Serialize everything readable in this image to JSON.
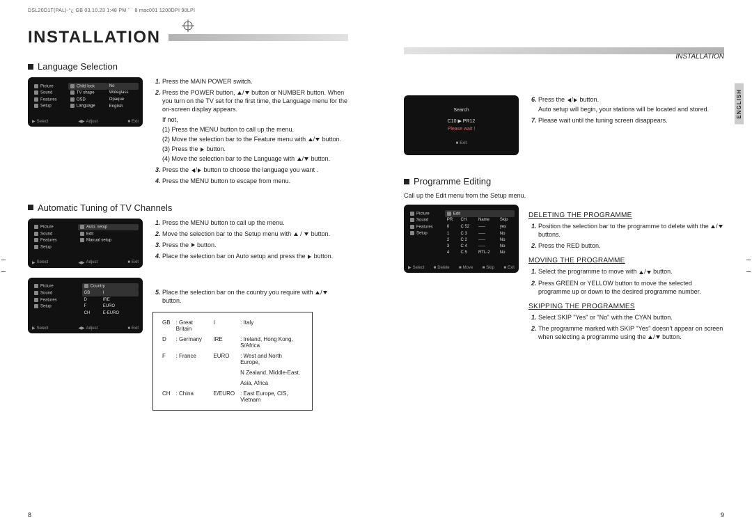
{
  "meta": {
    "print_header": "DSL20D1T(PAL)-°¿ GB  03.10.23 1:48 PM  ˘  ` 8   mac001   1200DPI 90LPI"
  },
  "left": {
    "title": "INSTALLATION",
    "sec_lang": "Language Selection",
    "sec_auto": "Automatic Tuning of TV Channels",
    "osd1": {
      "bot_select": "Select",
      "bot_adjust": "Adjust",
      "bot_exit": "Exit",
      "r1a": "Picture",
      "r1b": "Child lock",
      "r1c": "No",
      "r2a": "Sound",
      "r2b": "TV shape",
      "r2c": "Wideglass",
      "r3a": "Features",
      "r3b": "OSD",
      "r3c": "Opaque",
      "r4a": "Setup",
      "r4b": "Language",
      "r4c": "English"
    },
    "osd2": {
      "r1a": "Picture",
      "r1b": "Auto. setup",
      "r2a": "Sound",
      "r2b": "Edit",
      "r3a": "Features",
      "r3b": "Manual setup",
      "r4a": "Setup"
    },
    "osd3": {
      "r1a": "Picture",
      "r1b": "Country",
      "r2a": "Sound",
      "r2b": "GB",
      "r2c": "I",
      "r3a": "Features",
      "r3b": "D",
      "r3c": "IRE",
      "r4a": "Setup",
      "r4b": "F",
      "r4c": "EURO",
      "r5b": "CH",
      "r5c": "E-EURO"
    },
    "lang_steps": {
      "s1": "Press the MAIN POWER switch.",
      "s2a": "Press the POWER button, ",
      "s2b": " button or NUMBER button.  When you turn on the TV set for the first time, the Language menu for the on-screen display appears.",
      "s2c": "If not,",
      "s2d": "(1) Press the MENU button to call up the menu.",
      "s2e": "(2) Move the selection bar to the Feature menu with ",
      "s2f": " button.",
      "s2g": "(3) Press the ",
      "s2h": " button.",
      "s2i": "(4) Move the selection bar to the Language with ",
      "s2j": " button.",
      "s3a": "Press the ",
      "s3b": " button to choose the language you want .",
      "s4": "Press the MENU button to escape from menu."
    },
    "auto_steps": {
      "s1": "Press the MENU button to call up the menu.",
      "s2a": "Move the selection bar to the Setup menu with ",
      "s2b": " button.",
      "s3a": "Press the ",
      "s3b": " button.",
      "s4a": "Place the selection bar on Auto setup and press the ",
      "s4b": " button.",
      "s5a": "Place the selection bar on the country you require with ",
      "s5b": " button."
    },
    "countries": {
      "gb_a": "GB",
      "gb_b": ": Great Britain",
      "i_a": "I",
      "i_b": ": Italy",
      "d_a": "D",
      "d_b": ": Germany",
      "ire_a": "IRE",
      "ire_b": ": Ireland, Hong Kong, S/Africa",
      "f_a": "F",
      "f_b": ": France",
      "euro_a": "EURO",
      "euro_b": ": West and North Europe,",
      "euro_c": "N Zealand, Middle-East,",
      "euro_d": "Asia, Africa",
      "ch_a": "CH",
      "ch_b": ": China",
      "ee_a": "E/EURO",
      "ee_b": ": East Europe, CIS, Vietnam"
    },
    "page_num": "8"
  },
  "right": {
    "header": "INSTALLATION",
    "english_tab": "ENGLISH",
    "osd_search": {
      "title": "Search",
      "prog": "C10 ▶ PR12",
      "wait": "Please wait !",
      "exit": "Exit"
    },
    "sec_pe": "Programme Editing",
    "intro": "Call up the Edit menu from the Setup menu.",
    "osd_edit": {
      "left1": "Picture",
      "left2": "Sound",
      "left3": "Features",
      "left4": "Setup",
      "top_edit": "Edit",
      "h1": "",
      "h2": "PR",
      "h3": "CH",
      "h4": "Name",
      "h5": "Skip",
      "r0_1": "0",
      "r0_2": "C 52",
      "r0_3": "-----",
      "r0_4": "yes",
      "r1_1": "1",
      "r1_2": "C 3",
      "r1_3": "-----",
      "r1_4": "No",
      "r2_1": "2",
      "r2_2": "C 2",
      "r2_3": "-----",
      "r2_4": "No",
      "r3_1": "3",
      "r3_2": "C 4",
      "r3_3": "-----",
      "r3_4": "No",
      "r4_1": "4",
      "r4_2": "C 5",
      "r4_3": "RTL-2",
      "r4_4": "No",
      "bot_select": "Select",
      "bot_delete": "Delete",
      "bot_move": "Move",
      "bot_skip": "Skip",
      "bot_exit": "Exit"
    },
    "s6a": "Press the ",
    "s6b": " button.",
    "s6c": "Auto setup will begin, your stations will be located and stored.",
    "s7": "Please wait until the tuning screen disappears.",
    "h_del": "DELETING THE PROGRAMME",
    "del1a": "Position the selection bar to the programme to delete with the ",
    "del1b": " buttons.",
    "del2": "Press the RED button.",
    "h_mov": "MOVING THE PROGRAMME",
    "mov1a": "Select the programme to move with ",
    "mov1b": " button.",
    "mov2": "Press GREEN or YELLOW button to move the selected programme up or down to the desired programme number.",
    "h_skip": "SKIPPING THE PROGRAMMES",
    "skip1": "Select SKIP \"Yes\" or \"No\" with the CYAN button.",
    "skip2a": "The programme marked with SKIP \"Yes\" doesn't appear on screen when selecting a programme using the ",
    "skip2b": " button.",
    "page_num": "9"
  }
}
